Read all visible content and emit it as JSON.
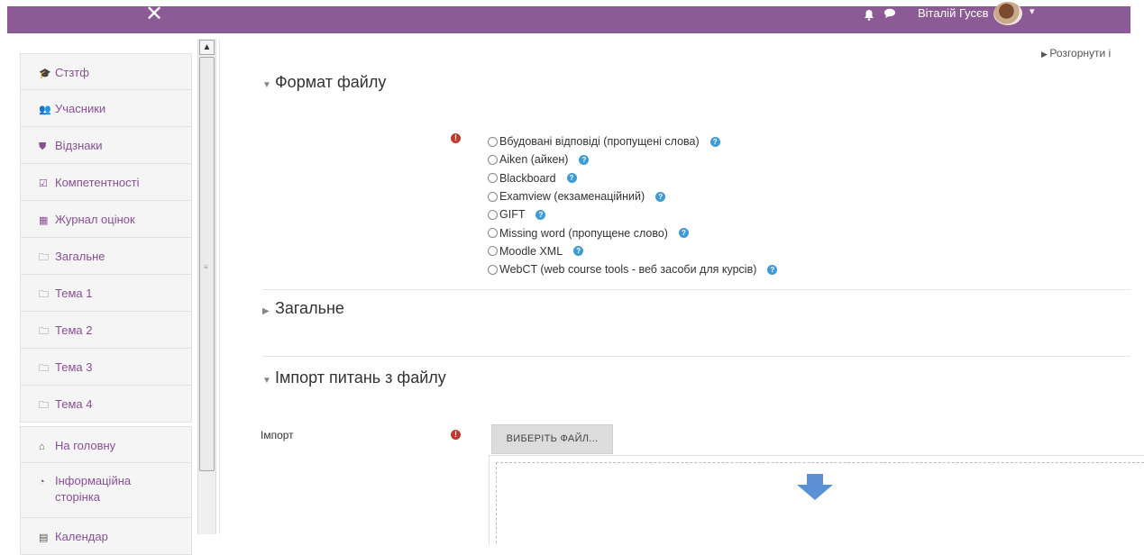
{
  "topbar": {
    "close_glyph": "✕",
    "bell_icon": "bell-icon",
    "chat_icon": "chat-icon",
    "username": "Віталій Гусєв",
    "caret": "▾",
    "brand_color": "#8c5a94"
  },
  "sidebar": {
    "scroll_up": "▲",
    "items": [
      {
        "icon": "graduation-cap-icon",
        "glyph": "🎓",
        "label": "Стзтф"
      },
      {
        "icon": "users-icon",
        "glyph": "👥",
        "label": "Учасники"
      },
      {
        "icon": "shield-icon",
        "glyph": "⛊",
        "label": "Відзнаки"
      },
      {
        "icon": "checkbox-icon",
        "glyph": "☑",
        "label": "Компетентності"
      },
      {
        "icon": "table-icon",
        "glyph": "▦",
        "label": "Журнал оцінок"
      },
      {
        "icon": "folder-icon",
        "glyph": "🗀",
        "label": "Загальне"
      },
      {
        "icon": "folder-icon",
        "glyph": "🗀",
        "label": "Тема 1"
      },
      {
        "icon": "folder-icon",
        "glyph": "🗀",
        "label": "Тема 2"
      },
      {
        "icon": "folder-icon",
        "glyph": "🗀",
        "label": "Тема 3"
      },
      {
        "icon": "folder-icon",
        "glyph": "🗀",
        "label": "Тема 4"
      },
      {
        "icon": "home-icon",
        "glyph": "⌂",
        "label": "На головну"
      },
      {
        "icon": "dashboard-icon",
        "glyph": "◔",
        "label": "Інформаційна сторінка"
      },
      {
        "icon": "calendar-icon",
        "glyph": "▤",
        "label": "Календар"
      }
    ]
  },
  "main": {
    "expand_all": "Розгорнути і",
    "sections": {
      "file_format": "Формат файлу",
      "general": "Загальне",
      "import_questions": "Імпорт питань з файлу"
    },
    "format_options": [
      {
        "label": "Вбудовані відповіді (пропущені слова)"
      },
      {
        "label": "Aiken (айкен)"
      },
      {
        "label": "Blackboard"
      },
      {
        "label": "Examview (екзаменаційний)"
      },
      {
        "label": "GIFT"
      },
      {
        "label": "Missing word (пропущене слово)"
      },
      {
        "label": "Moodle XML"
      },
      {
        "label": "WebCT (web course tools - веб засоби для курсів)"
      }
    ],
    "import_label": "Імпорт",
    "choose_file_button": "ВИБЕРІТЬ ФАЙЛ..."
  }
}
